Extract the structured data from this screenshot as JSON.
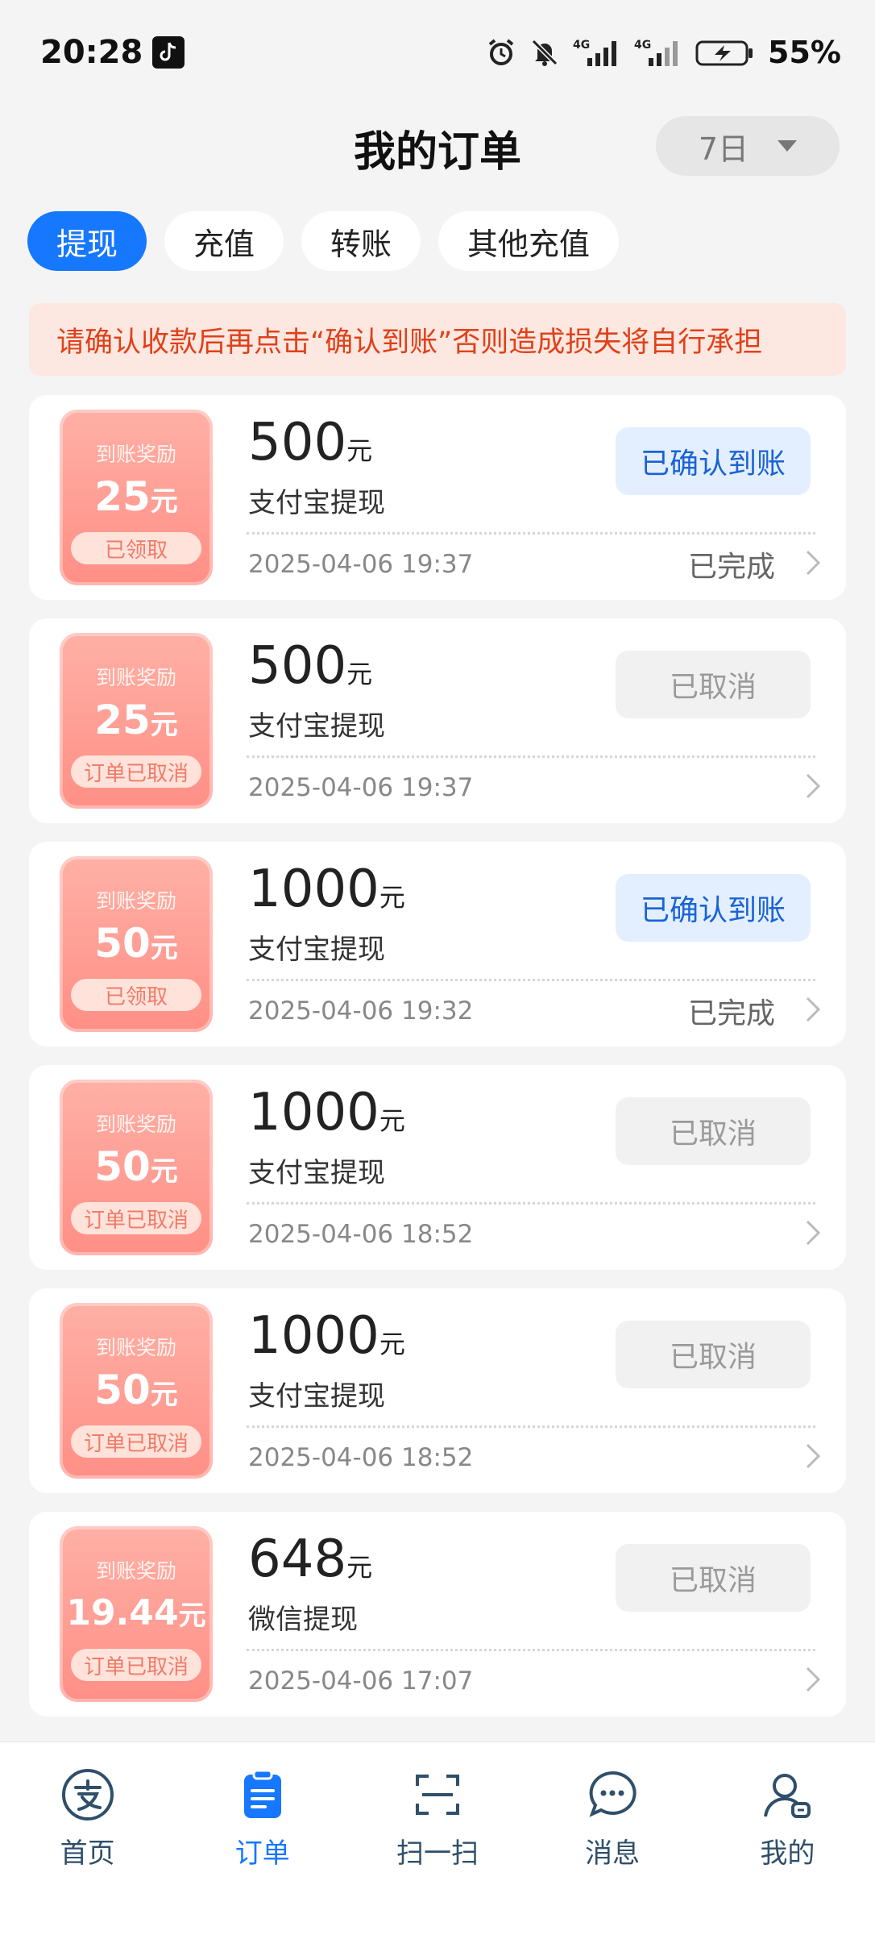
{
  "status_bar": {
    "time": "20:28",
    "battery": "55%",
    "icons": [
      "tiktok-icon",
      "alarm-icon",
      "mute-bell-icon",
      "signal-4g-icon",
      "signal-4g-icon",
      "battery-charging-icon"
    ]
  },
  "header": {
    "title": "我的订单",
    "range": "7日"
  },
  "tabs": [
    {
      "label": "提现",
      "active": true
    },
    {
      "label": "充值",
      "active": false
    },
    {
      "label": "转账",
      "active": false
    },
    {
      "label": "其他充值",
      "active": false
    }
  ],
  "warning": "请确认收款后再点击“确认到账”否则造成损失将自行承担",
  "orders": [
    {
      "reward_title": "到账奖励",
      "reward_amount": "25",
      "reward_unit": "元",
      "reward_badge": "已领取",
      "amount": "500",
      "amount_unit": "元",
      "method": "支付宝提现",
      "datetime": "2025-04-06 19:37",
      "status": "已确认到账",
      "state": "confirmed",
      "done": "已完成"
    },
    {
      "reward_title": "到账奖励",
      "reward_amount": "25",
      "reward_unit": "元",
      "reward_badge": "订单已取消",
      "amount": "500",
      "amount_unit": "元",
      "method": "支付宝提现",
      "datetime": "2025-04-06 19:37",
      "status": "已取消",
      "state": "cancelled",
      "done": ""
    },
    {
      "reward_title": "到账奖励",
      "reward_amount": "50",
      "reward_unit": "元",
      "reward_badge": "已领取",
      "amount": "1000",
      "amount_unit": "元",
      "method": "支付宝提现",
      "datetime": "2025-04-06 19:32",
      "status": "已确认到账",
      "state": "confirmed",
      "done": "已完成"
    },
    {
      "reward_title": "到账奖励",
      "reward_amount": "50",
      "reward_unit": "元",
      "reward_badge": "订单已取消",
      "amount": "1000",
      "amount_unit": "元",
      "method": "支付宝提现",
      "datetime": "2025-04-06 18:52",
      "status": "已取消",
      "state": "cancelled",
      "done": ""
    },
    {
      "reward_title": "到账奖励",
      "reward_amount": "50",
      "reward_unit": "元",
      "reward_badge": "订单已取消",
      "amount": "1000",
      "amount_unit": "元",
      "method": "支付宝提现",
      "datetime": "2025-04-06 18:52",
      "status": "已取消",
      "state": "cancelled",
      "done": ""
    },
    {
      "reward_title": "到账奖励",
      "reward_amount": "19.44",
      "reward_unit": "元",
      "reward_badge": "订单已取消",
      "amount": "648",
      "amount_unit": "元",
      "method": "微信提现",
      "datetime": "2025-04-06 17:07",
      "status": "已取消",
      "state": "cancelled",
      "done": ""
    }
  ],
  "nav": [
    {
      "label": "首页",
      "icon": "alipay-icon",
      "active": false
    },
    {
      "label": "订单",
      "icon": "clipboard-icon",
      "active": true
    },
    {
      "label": "扫一扫",
      "icon": "scan-icon",
      "active": false
    },
    {
      "label": "消息",
      "icon": "chat-icon",
      "active": false
    },
    {
      "label": "我的",
      "icon": "user-icon",
      "active": false
    }
  ],
  "colors": {
    "accent": "#1677ff",
    "warning_text": "#e0401a",
    "warning_bg": "#fce8e0",
    "reward_bg": "#ff8f86"
  }
}
